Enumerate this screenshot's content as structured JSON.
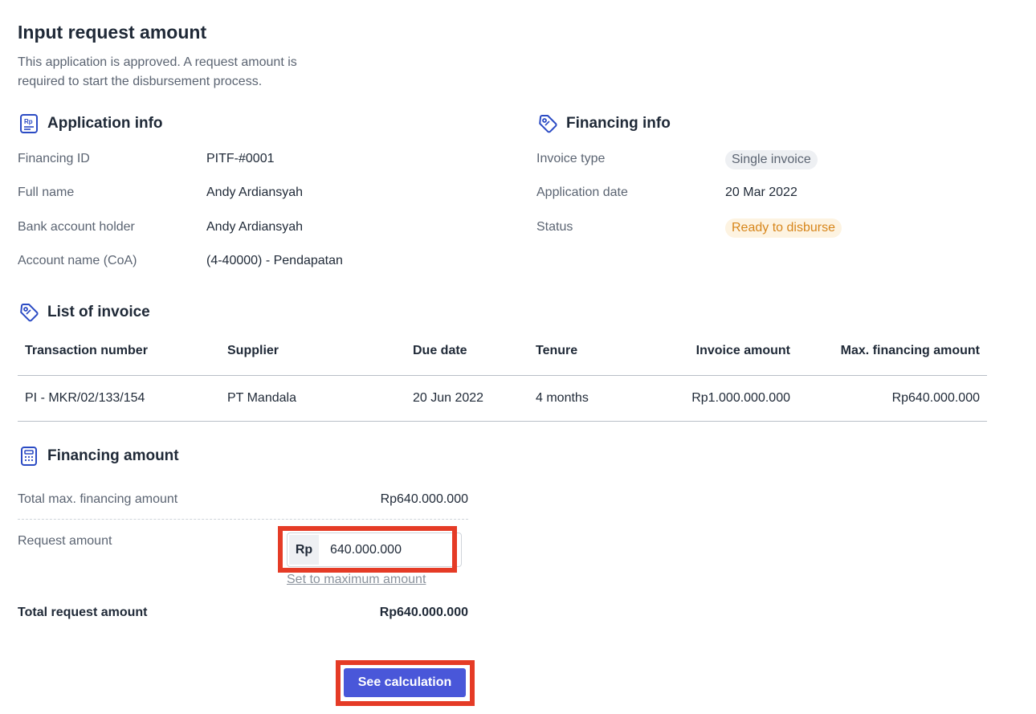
{
  "page": {
    "title": "Input request amount",
    "description": "This application is approved. A request amount is required to start the disbursement process."
  },
  "application_info": {
    "title": "Application info",
    "icon": "rp-document-icon",
    "rows": [
      {
        "label": "Financing ID",
        "value": "PITF-#0001"
      },
      {
        "label": "Full name",
        "value": "Andy Ardiansyah"
      },
      {
        "label": "Bank account holder",
        "value": "Andy Ardiansyah"
      },
      {
        "label": "Account name (CoA)",
        "value": "(4-40000) - Pendapatan"
      }
    ]
  },
  "financing_info": {
    "title": "Financing info",
    "icon": "tag-icon",
    "invoice_type_label": "Invoice type",
    "invoice_type_value": "Single invoice",
    "application_date_label": "Application date",
    "application_date_value": "20 Mar 2022",
    "status_label": "Status",
    "status_value": "Ready to disburse"
  },
  "invoice_list": {
    "title": "List of invoice",
    "icon": "tag-icon",
    "columns": [
      "Transaction number",
      "Supplier",
      "Due date",
      "Tenure",
      "Invoice amount",
      "Max. financing amount"
    ],
    "rows": [
      [
        "PI - MKR/02/133/154",
        "PT Mandala",
        "20 Jun 2022",
        "4 months",
        "Rp1.000.000.000",
        "Rp640.000.000"
      ]
    ]
  },
  "financing_amount": {
    "title": "Financing amount",
    "icon": "calculator-icon",
    "total_max_label": "Total max. financing amount",
    "total_max_value": "Rp640.000.000",
    "request_label": "Request amount",
    "currency_prefix": "Rp",
    "request_value": "640.000.000",
    "set_max_link": "Set to maximum amount",
    "total_request_label": "Total request amount",
    "total_request_value": "Rp640.000.000"
  },
  "actions": {
    "see_calculation": "See calculation"
  },
  "colors": {
    "primary": "#4957d9",
    "highlight": "#e53b26",
    "status_orange": "#d7861b",
    "icon_blue": "#2b4bc4"
  }
}
